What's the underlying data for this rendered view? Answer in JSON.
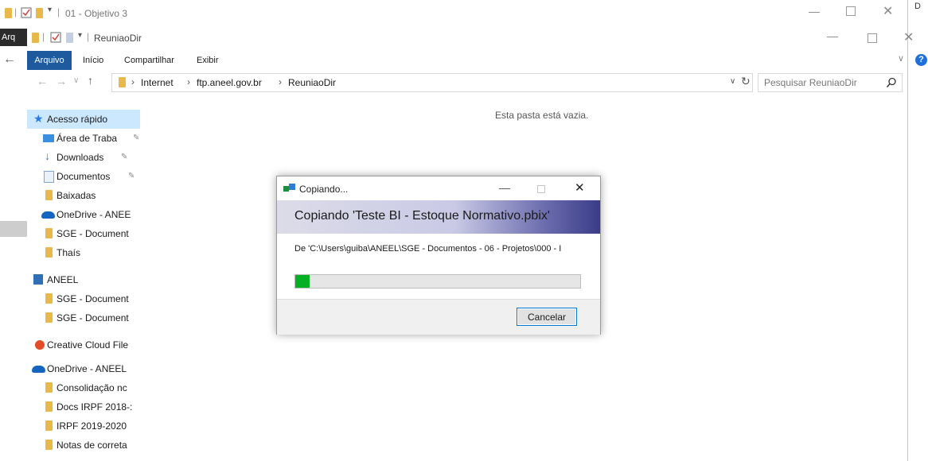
{
  "back_window": {
    "title": "01 - Objetivo 3",
    "arquivo_partial": "Arq"
  },
  "window": {
    "title": "ReuniaoDir"
  },
  "ribbon": {
    "tabs": [
      "Arquivo",
      "Início",
      "Compartilhar",
      "Exibir"
    ]
  },
  "address": {
    "crumbs": [
      "Internet",
      "ftp.aneel.gov.br",
      "ReuniaoDir"
    ]
  },
  "search": {
    "placeholder": "Pesquisar ReuniaoDir"
  },
  "content": {
    "empty_message": "Esta pasta está vazia."
  },
  "sidebar": {
    "items": [
      {
        "label": "Acesso rápido",
        "icon": "star-icon"
      },
      {
        "label": "Área de Traba",
        "icon": "desktop-icon",
        "pinned": true
      },
      {
        "label": "Downloads",
        "icon": "download-icon",
        "pinned": true
      },
      {
        "label": "Documentos",
        "icon": "documents-icon",
        "pinned": true
      },
      {
        "label": "Baixadas",
        "icon": "folder-icon"
      },
      {
        "label": "OneDrive - ANEE",
        "icon": "cloud-icon"
      },
      {
        "label": "SGE - Document",
        "icon": "folder-icon"
      },
      {
        "label": "Thaís",
        "icon": "folder-icon"
      },
      {
        "label": "ANEEL",
        "icon": "building-icon"
      },
      {
        "label": "SGE - Document",
        "icon": "folder-icon"
      },
      {
        "label": "SGE - Document",
        "icon": "folder-icon"
      },
      {
        "label": "Creative Cloud File",
        "icon": "creative-cloud-icon"
      },
      {
        "label": "OneDrive - ANEEL",
        "icon": "cloud-icon"
      },
      {
        "label": "Consolidação nc",
        "icon": "folder-icon"
      },
      {
        "label": "Docs IRPF 2018-:",
        "icon": "folder-icon"
      },
      {
        "label": "IRPF 2019-2020",
        "icon": "folder-icon"
      },
      {
        "label": "Notas de correta",
        "icon": "folder-icon"
      }
    ]
  },
  "dialog": {
    "title": "Copiando...",
    "heading": "Copiando 'Teste BI - Estoque Normativo.pbix'",
    "from_text": "De 'C:\\Users\\guiba\\ANEEL\\SGE - Documentos - 06 - Projetos\\000 - I",
    "progress": 0.05,
    "cancel_label": "Cancelar"
  },
  "colors": {
    "accent": "#0078d7",
    "progress": "#06b025",
    "arquivo_tab": "#1f5a9e",
    "selected_nav": "#cce8ff"
  }
}
